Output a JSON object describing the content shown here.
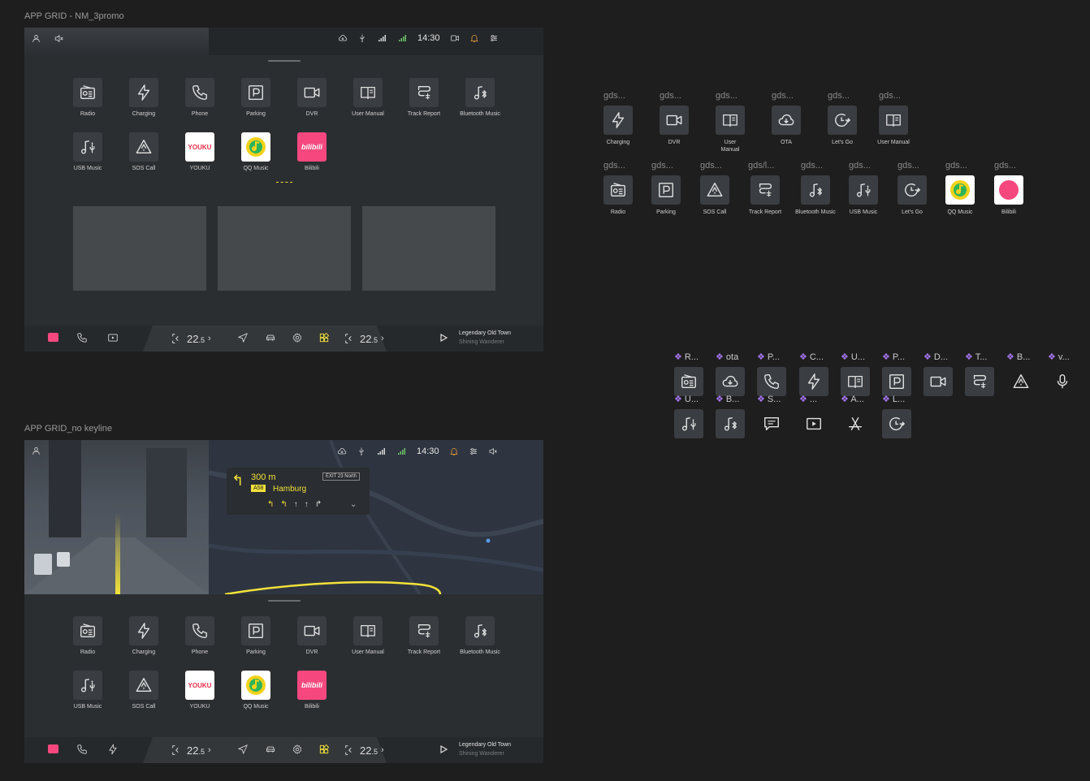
{
  "frames": {
    "promo": {
      "label": "APP GRID - NM_3promo",
      "time": "14:30",
      "apps_row1": [
        "Radio",
        "Charging",
        "Phone",
        "Parking",
        "DVR",
        "User Manual",
        "Track Report",
        "Bluetooth Music"
      ],
      "apps_row2": [
        "USB Music",
        "SOS Call",
        "YOUKU",
        "QQ Music",
        "Bilibili"
      ],
      "brand_youku": "YOUKU",
      "brand_bilibili": "bilibili",
      "temp_left": "22",
      "temp_left_decimal": ".5",
      "temp_right": "22",
      "temp_right_decimal": ".5",
      "song_title": "Legendary Old Town",
      "song_artist": "Shining Wanderer"
    },
    "nokeyline": {
      "label": "APP GRID_no keyline",
      "time": "14:30",
      "nav_distance": "300 m",
      "nav_road": "A58",
      "nav_city": "Hamburg",
      "nav_exit": "EXIT 23 North",
      "apps_row1": [
        "Radio",
        "Charging",
        "Phone",
        "Parking",
        "DVR",
        "User Manual",
        "Track Report",
        "Bluetooth Music"
      ],
      "apps_row2": [
        "USB Music",
        "SOS Call",
        "YOUKU",
        "QQ Music",
        "Bilibili"
      ],
      "brand_youku": "YOUKU",
      "brand_bilibili": "bilibili",
      "temp_left": "22",
      "temp_left_decimal": ".5",
      "temp_right": "22",
      "temp_right_decimal": ".5",
      "song_title": "Legendary Old Town",
      "song_artist": "Shining Wanderer"
    }
  },
  "library_row1": {
    "labels": [
      "gds...",
      "gds...",
      "gds...",
      "gds...",
      "gds...",
      "gds..."
    ],
    "apps": [
      "Charging",
      "DVR",
      "User Manual",
      "OTA",
      "Let's Go",
      "User Manual"
    ],
    "icons": [
      "lightning-icon",
      "video-icon",
      "book-icon",
      "cloud-icon",
      "clock-arrow-icon",
      "book-icon"
    ]
  },
  "library_row2": {
    "labels": [
      "gds...",
      "gds...",
      "gds...",
      "gds/l...",
      "gds...",
      "gds...",
      "gds...",
      "gds...",
      "gds..."
    ],
    "apps": [
      "Radio",
      "Parking",
      "SOS Call",
      "Track Report",
      "Bluetooth Music",
      "USB Music",
      "Let's Go",
      "QQ Music",
      "Bilibili"
    ],
    "icons": [
      "radio-icon",
      "parking-icon",
      "sos-icon",
      "track-icon",
      "bt-music-icon",
      "usb-music-icon",
      "clock-arrow-icon",
      "qqmusic-logo",
      "bilibili-logo"
    ]
  },
  "components_row1": {
    "labels": [
      "R...",
      "ota",
      "P...",
      "C...",
      "U...",
      "P...",
      "D...",
      "T...",
      "B...",
      "v..."
    ],
    "icons": [
      "radio-icon",
      "cloud-download-icon",
      "phone-icon",
      "lightning-icon",
      "book-icon",
      "parking-icon",
      "video-icon",
      "track-icon",
      "sos-icon",
      "microphone-icon"
    ]
  },
  "components_row2": {
    "labels": [
      "U...",
      "B...",
      "S...",
      "...",
      "A...",
      "L..."
    ],
    "icons": [
      "usb-music-icon",
      "bt-music-icon",
      "message-icon",
      "play-icon",
      "app-store-icon",
      "clock-arrow-icon"
    ]
  },
  "colors": {
    "accent_yellow": "#f3e23a",
    "component_purple": "#a676f0",
    "bilibili_pink": "#f6487e"
  }
}
